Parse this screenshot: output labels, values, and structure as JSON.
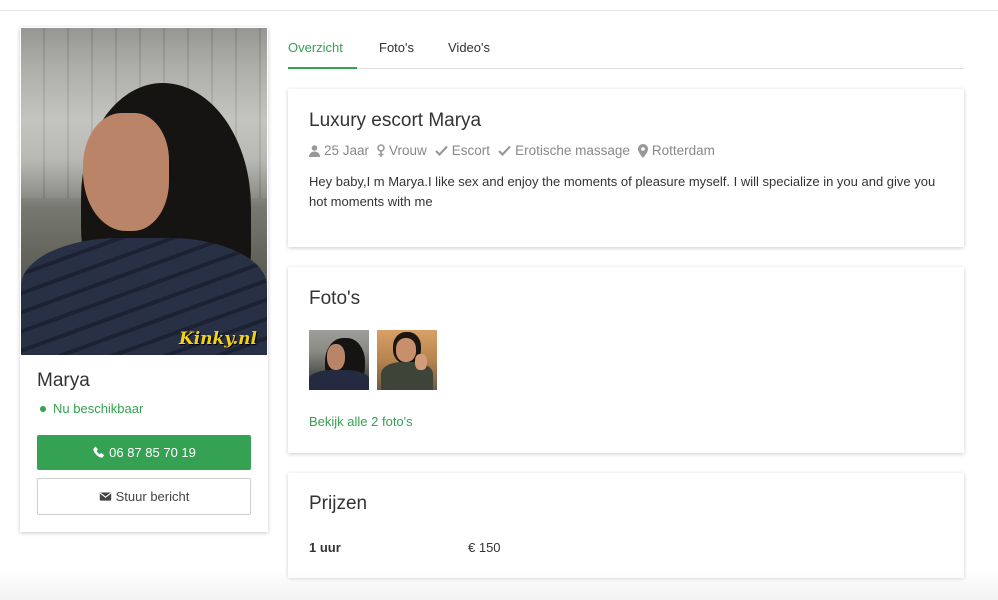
{
  "profile": {
    "photo_watermark": "Kinky.nl",
    "name": "Marya",
    "status": "Nu beschikbaar",
    "phone_button": "06 87 85 70 19",
    "message_button": "Stuur bericht"
  },
  "tabs": [
    {
      "label": "Overzicht",
      "active": true
    },
    {
      "label": "Foto's",
      "active": false
    },
    {
      "label": "Video's",
      "active": false
    }
  ],
  "about": {
    "title": "Luxury escort Marya",
    "meta": [
      {
        "icon": "person-icon",
        "text": "25 Jaar"
      },
      {
        "icon": "gender-female-icon",
        "text": "Vrouw"
      },
      {
        "icon": "check-icon",
        "text": "Escort"
      },
      {
        "icon": "check-icon",
        "text": "Erotische massage"
      },
      {
        "icon": "map-marker-icon",
        "text": "Rotterdam"
      }
    ],
    "description": "Hey baby,I m Marya.I like sex and enjoy the moments of pleasure myself. I will specialize in you and give you hot moments with me"
  },
  "photos": {
    "title": "Foto's",
    "view_all": "Bekijk alle 2 foto's"
  },
  "prices": {
    "title": "Prijzen",
    "rows": [
      {
        "label": "1 uur",
        "value": "€ 150"
      }
    ]
  },
  "colors": {
    "accent": "#35a152",
    "watermark": "#f3d21a"
  }
}
